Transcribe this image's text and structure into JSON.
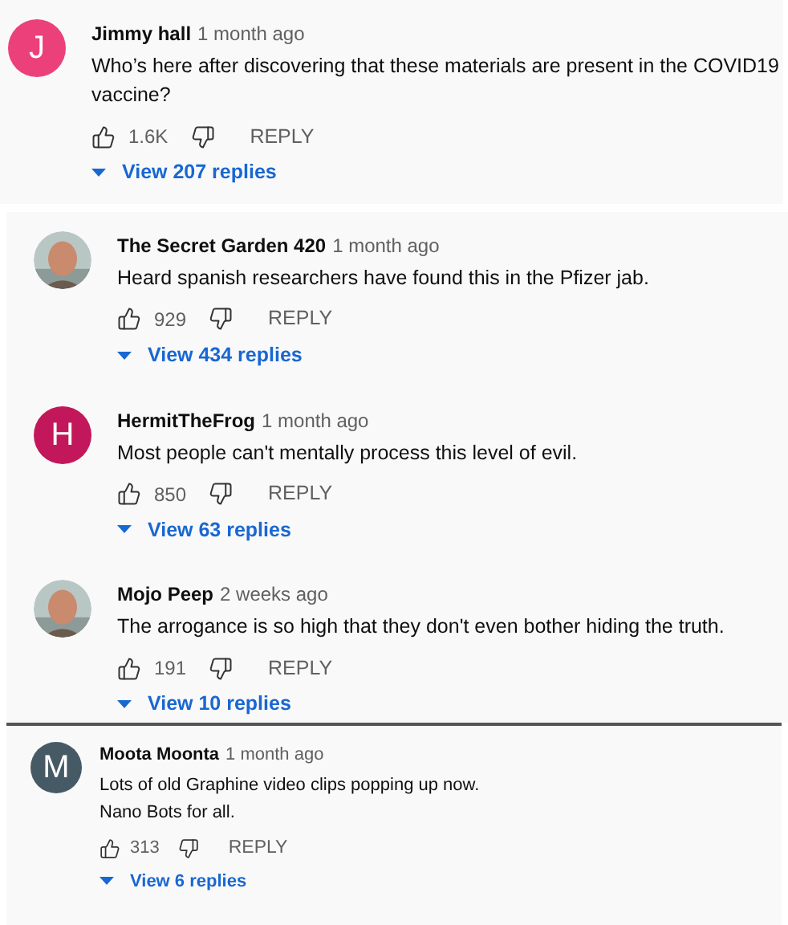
{
  "sections": [
    {
      "comments": [
        {
          "author": "Jimmy hall",
          "time": "1 month ago",
          "text": "Who’s here after discovering that these materials are present in the COVID19 vaccine?",
          "likes": "1.6K",
          "reply": "REPLY",
          "view_replies": "View 207 replies",
          "avatar": {
            "kind": "letter",
            "letter": "J",
            "color": "#ec407a"
          }
        }
      ]
    },
    {
      "comments": [
        {
          "author": "The Secret Garden 420",
          "time": "1 month ago",
          "text": "Heard spanish researchers have found this in the Pfizer jab.",
          "likes": "929",
          "reply": "REPLY",
          "view_replies": "View 434 replies"
        },
        {
          "author": "HermitTheFrog",
          "time": "1 month ago",
          "text": "Most people can't mentally process this level of evil.",
          "likes": "850",
          "reply": "REPLY",
          "view_replies": "View 63 replies",
          "avatar": {
            "kind": "letter",
            "letter": "H",
            "color": "#c2185b"
          }
        },
        {
          "author": "Mojo Peep",
          "time": "2 weeks ago",
          "text": "The arrogance is so high that they don't even bother hiding the truth.",
          "likes": "191",
          "reply": "REPLY",
          "view_replies": "View 10 replies"
        }
      ]
    },
    {
      "comments": [
        {
          "author": "Moota Moonta",
          "time": "1 month ago",
          "text": "Lots of old Graphine video clips popping up now.\nNano Bots for all.",
          "likes": "313",
          "reply": "REPLY",
          "view_replies": "View 6 replies",
          "avatar": {
            "kind": "letter",
            "letter": "M",
            "color": "#455a64"
          }
        }
      ]
    }
  ]
}
